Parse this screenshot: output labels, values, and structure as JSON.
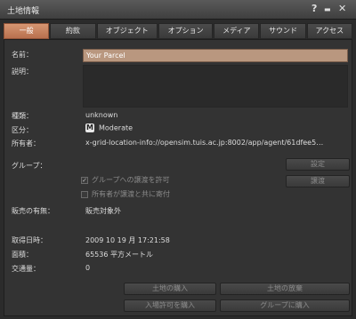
{
  "window": {
    "title": "土地情報",
    "help_icon": "?",
    "minimize_icon": "▬",
    "close_icon": "✕"
  },
  "tabs": [
    "一般",
    "約款",
    "オブジェクト",
    "オプション",
    "メディア",
    "サウンド",
    "アクセス"
  ],
  "labels": {
    "name": "名前：",
    "description": "説明：",
    "type": "種類：",
    "rating": "区分：",
    "owner": "所有者：",
    "group": "グループ：",
    "for_sale": "販売の有無：",
    "acquired": "取得日時：",
    "area": "面積：",
    "traffic": "交通量："
  },
  "values": {
    "name": "Your Parcel",
    "type": "unknown",
    "rating_badge": "M",
    "rating": "Moderate",
    "owner": "x-grid-location-info://opensim.tuis.ac.jp:8002/app/agent/61dfee5…",
    "for_sale": "販売対象外",
    "acquired": "2009 10 19 月 17:21:58",
    "area": "65536 平方メートル",
    "traffic": "0"
  },
  "checkboxes": {
    "allow_deed": "グループへの譲渡を許可",
    "contribute": "所有者が譲渡と共に寄付"
  },
  "buttons": {
    "set": "設定",
    "deed": "譲渡",
    "buy_land": "土地の購入",
    "abandon_land": "土地の放棄",
    "buy_pass": "入場許可を購入",
    "buy_for_group": "グループに購入"
  }
}
